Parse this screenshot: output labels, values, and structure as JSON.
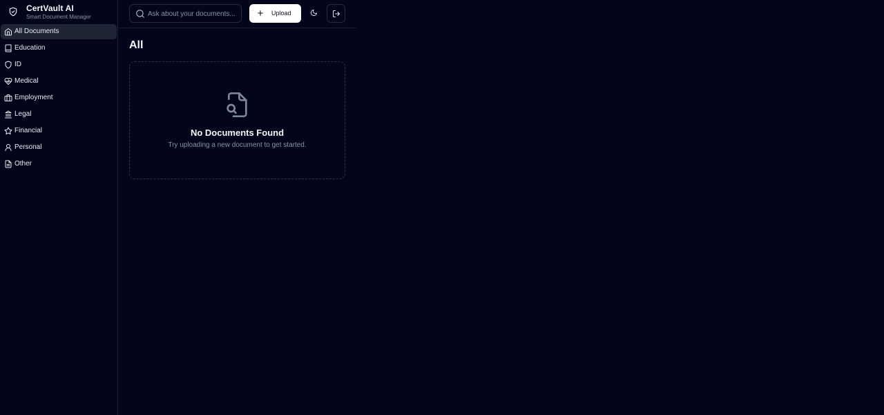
{
  "brand": {
    "title": "CertVault AI",
    "subtitle": "Smart Document Manager",
    "icon": "shield-check-icon"
  },
  "sidebar": {
    "items": [
      {
        "label": "All Documents",
        "icon": "home-icon",
        "active": true
      },
      {
        "label": "Education",
        "icon": "book-icon",
        "active": false
      },
      {
        "label": "ID",
        "icon": "shield-icon",
        "active": false
      },
      {
        "label": "Medical",
        "icon": "heart-pulse-icon",
        "active": false
      },
      {
        "label": "Employment",
        "icon": "briefcase-icon",
        "active": false
      },
      {
        "label": "Legal",
        "icon": "landmark-icon",
        "active": false
      },
      {
        "label": "Financial",
        "icon": "star-icon",
        "active": false
      },
      {
        "label": "Personal",
        "icon": "user-icon",
        "active": false
      },
      {
        "label": "Other",
        "icon": "file-text-icon",
        "active": false
      }
    ]
  },
  "toolbar": {
    "search_placeholder": "Ask about your documents...",
    "search_value": "",
    "upload_label": "Upload",
    "theme_icon": "moon-icon",
    "logout_icon": "log-out-icon"
  },
  "main": {
    "title": "All",
    "empty": {
      "icon": "file-search-icon",
      "title": "No Documents Found",
      "subtitle": "Try uploading a new document to get started."
    }
  },
  "colors": {
    "background": "#03061a",
    "active_item": "#1f2534",
    "border": "#262c3b",
    "muted_text": "#8a92a6",
    "text": "#f5f7fb",
    "button_bg": "#ffffff"
  }
}
